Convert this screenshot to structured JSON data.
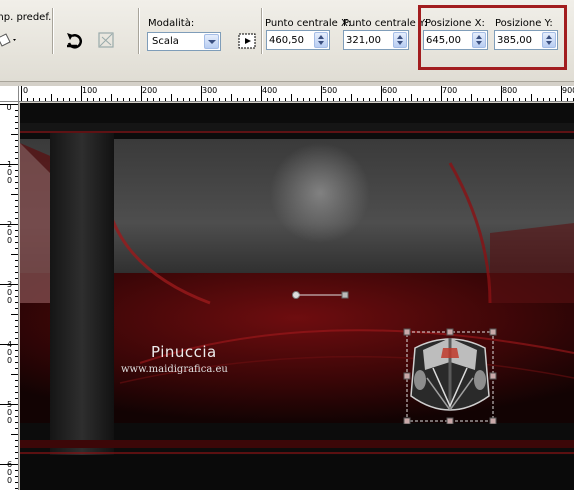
{
  "toolbar": {
    "preset_label": "mp. predef.:",
    "mode_label": "Modalità:",
    "mode_value": "Scala",
    "center_x_label": "Punto centrale X:",
    "center_x_value": "460,50",
    "center_y_label": "Punto centrale Y:",
    "center_y_value": "321,00",
    "pos_x_label": "Posizione X:",
    "pos_x_value": "645,00",
    "pos_y_label": "Posizione Y:",
    "pos_y_value": "385,00",
    "highlight_color": "#a21d1f"
  },
  "rulers": {
    "horizontal": [
      "0",
      "100",
      "200",
      "300",
      "400",
      "500",
      "600",
      "700",
      "800",
      "900"
    ],
    "vertical": [
      "0",
      "100",
      "200",
      "300",
      "400",
      "500",
      "600"
    ]
  },
  "canvas": {
    "watermark_name": "Pinuccia",
    "watermark_url": "www.maidigrafica.eu",
    "accent_red": "#8a1214",
    "background": "#0e0e0e"
  },
  "icons": {
    "preset": "preset-picker-icon",
    "reset": "reset-arrow-icon",
    "transform": "transform-icon",
    "center": "center-point-icon",
    "selection_object": "car-grille-icon"
  }
}
